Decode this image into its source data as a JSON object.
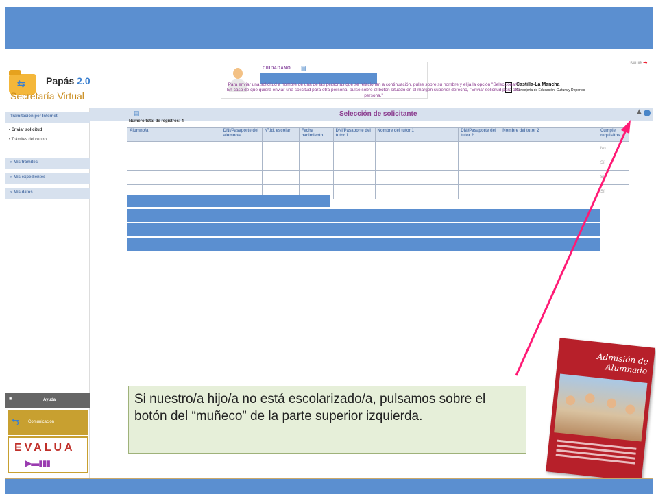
{
  "header": {
    "logo_title": "Papás",
    "logo_version": "2.0",
    "logo_subtitle": "Secretaría Virtual",
    "citizen_label": "CIUDADANO",
    "logout_label": "SALIR",
    "org_name": "Castilla-La Mancha",
    "org_department": "Consejería de Educación, Cultura y Deportes"
  },
  "sidebar": {
    "section_title": "Tramitación por Internet",
    "sub_items": [
      {
        "label": "Enviar solicitud"
      },
      {
        "label": "Trámites del centro"
      }
    ],
    "items": [
      {
        "label": "Mis trámites"
      },
      {
        "label": "Mis expedientes"
      },
      {
        "label": "Mis datos"
      }
    ],
    "help_label": "Ayuda",
    "communication_label": "Comunicación",
    "evalua_label": "EVALUA"
  },
  "main": {
    "title": "Selección de solicitante",
    "instructions": "Para enviar una solicitud a nombre de una de las personas que se relacionan a continuación, pulse sobre su nombre y elija la opción \"Seleccionar\". En caso de que quiera enviar una solicitud para otra persona, pulse sobre el botón situado en el margen superior derecho, \"Enviar solicitud para otra persona.\"",
    "record_count": "Número total de registros: 4",
    "table": {
      "headers": [
        "Alumno/a",
        "DNI/Pasaporte del alumno/a",
        "Nº.Id. escolar",
        "Fecha nacimiento",
        "DNI/Pasaporte del tutor 1",
        "Nombre del tutor 1",
        "DNI/Pasaporte del tutor 2",
        "Nombre del tutor 2",
        "Cumple requisitos"
      ],
      "rows": [
        {
          "requisitos": "No"
        },
        {
          "requisitos": "Sí"
        },
        {
          "requisitos": "Sí"
        },
        {
          "requisitos": "Sí"
        }
      ]
    }
  },
  "callout": {
    "text": "Si nuestro/a hijo/a no está escolarizado/a, pulsamos sobre el botón del “muñeco” de la parte superior izquierda."
  },
  "booklet": {
    "title": "Admisión de Alumnado"
  },
  "colors": {
    "banner_blue": "#5b8fd0",
    "title_purple": "#8a3b8e",
    "arrow_pink": "#ff1a75",
    "callout_bg": "#e6efd9"
  }
}
